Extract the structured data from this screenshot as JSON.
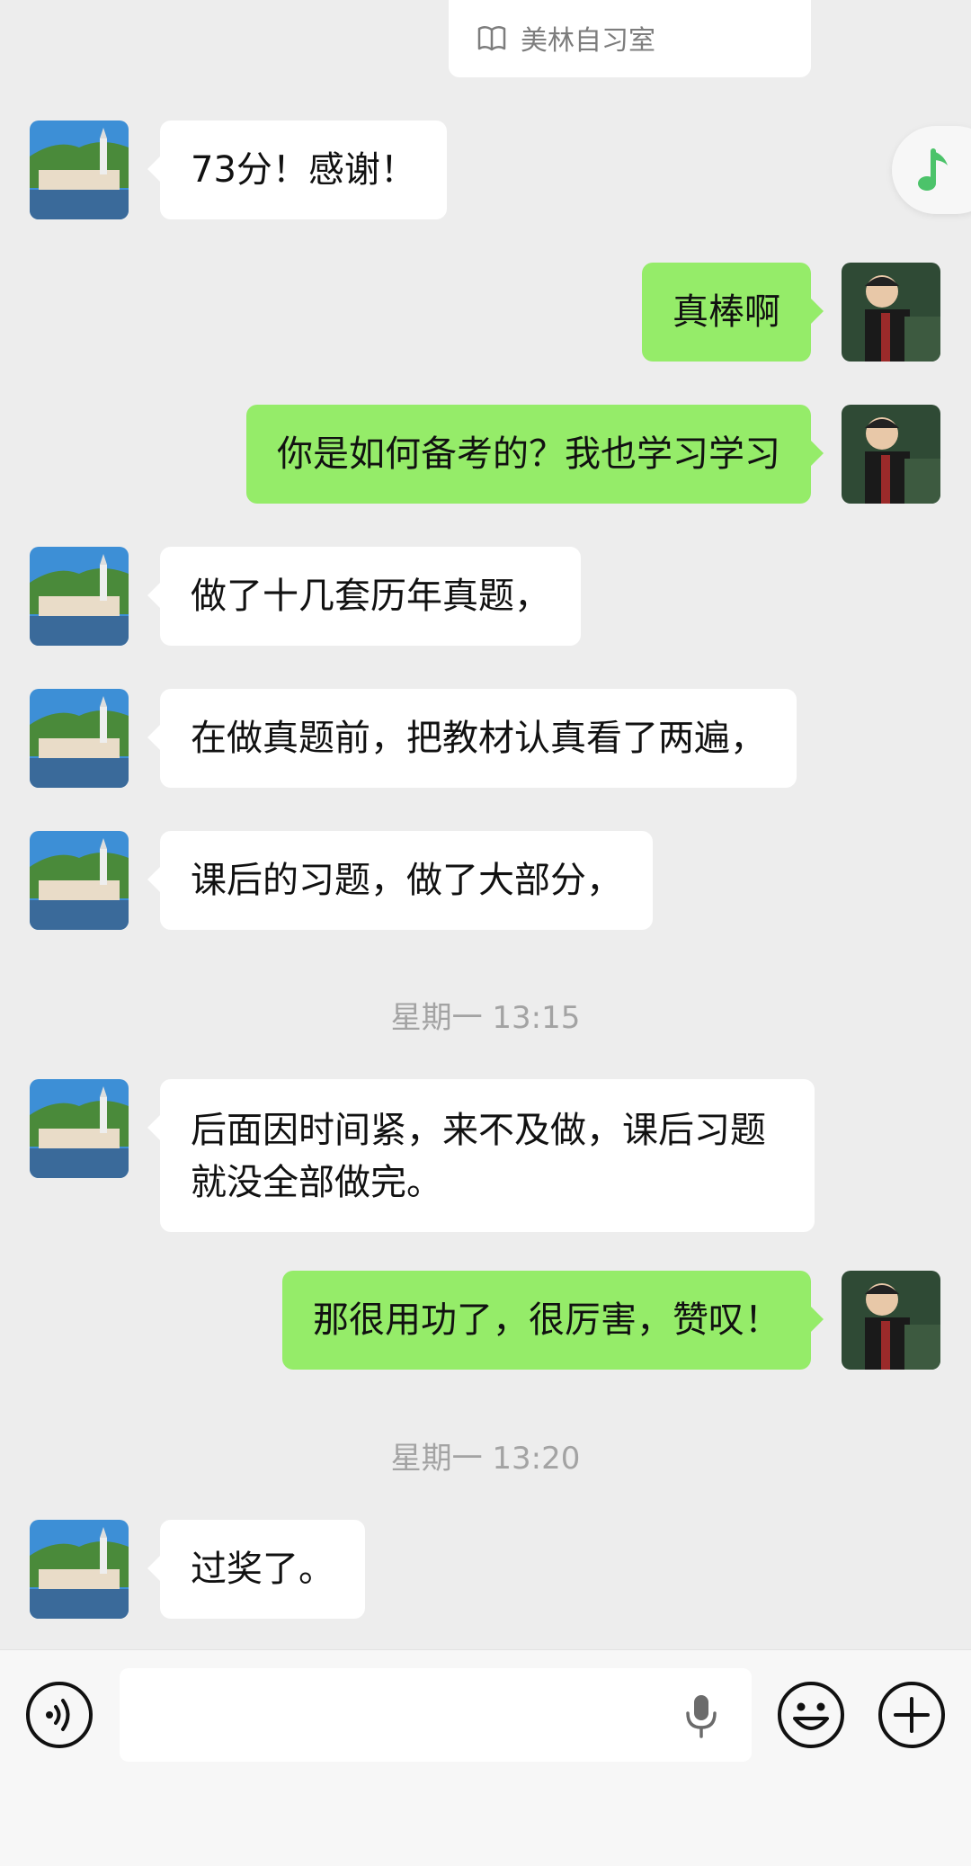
{
  "pinned_card": {
    "source_label": "美林自习室"
  },
  "messages": [
    {
      "id": "m1",
      "side": "in",
      "text": "73分！感谢！"
    },
    {
      "id": "m2",
      "side": "out",
      "text": "真棒啊"
    },
    {
      "id": "m3",
      "side": "out",
      "text": "你是如何备考的？我也学习学习"
    },
    {
      "id": "m4",
      "side": "in",
      "text": "做了十几套历年真题，"
    },
    {
      "id": "m5",
      "side": "in",
      "text": "在做真题前，把教材认真看了两遍，"
    },
    {
      "id": "m6",
      "side": "in",
      "text": "课后的习题，做了大部分，"
    },
    {
      "id": "t1",
      "type": "timestamp",
      "text": "星期一 13:15"
    },
    {
      "id": "m7",
      "side": "in",
      "text": "后面因时间紧，来不及做，课后习题就没全部做完。"
    },
    {
      "id": "m8",
      "side": "out",
      "text": "那很用功了，很厉害，赞叹！"
    },
    {
      "id": "t2",
      "type": "timestamp",
      "text": "星期一 13:20"
    },
    {
      "id": "m9",
      "side": "in",
      "text": "过奖了。"
    }
  ],
  "input_bar": {
    "icons": [
      "voice-toggle-icon",
      "microphone-icon",
      "emoji-icon",
      "plus-icon"
    ]
  },
  "floating": {
    "icon": "music-note-icon",
    "color": "#4cc36a"
  },
  "colors": {
    "outgoing_bubble": "#95ec69",
    "incoming_bubble": "#ffffff",
    "background": "#ededed"
  }
}
